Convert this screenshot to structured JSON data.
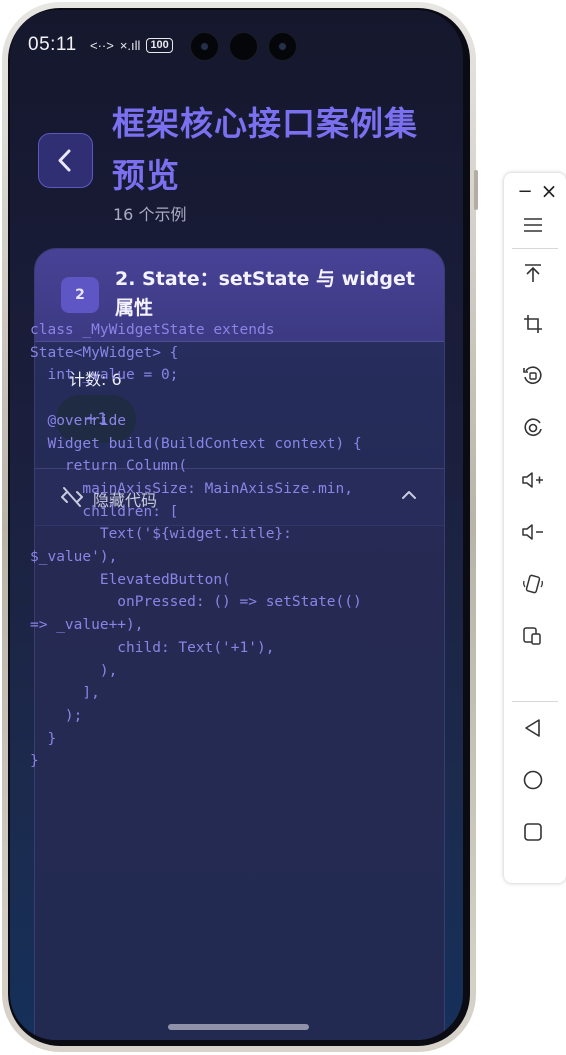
{
  "status_bar": {
    "time": "05:11",
    "data_icon": "<··>",
    "signal": "×.ıll",
    "battery": "100"
  },
  "header": {
    "title": "框架核心接口案例集预览",
    "subtitle": "16 个示例"
  },
  "example": {
    "number": "2",
    "title": "2. State：setState 与 widget 属性",
    "count_text": "计数: 6",
    "button_label": "+1",
    "code_toggle_label": "隐藏代码",
    "code": "class _MyWidgetState extends\nState<MyWidget> {\n  int _value = 0;\n\n  @override\n  Widget build(BuildContext context) {\n    return Column(\n      mainAxisSize: MainAxisSize.min,\n      children: [\n        Text('${widget.title}:\n$_value'),\n        ElevatedButton(\n          onPressed: () => setState(()\n=> _value++),\n          child: Text('+1'),\n        ),\n      ],\n    );\n  }\n}"
  },
  "toolbar": {
    "minimize": "−",
    "close": "×",
    "items": [
      "menu-icon",
      "pin-top-icon",
      "crop-icon",
      "rotate-icon",
      "screen-record-icon",
      "volume-up-icon",
      "volume-down-icon",
      "shake-icon",
      "multi-screen-icon",
      "back-nav-icon",
      "home-nav-icon",
      "recent-apps-icon"
    ]
  },
  "colors": {
    "accent": "#7b70f0",
    "card_header": "#484296",
    "background": "#1b1e3c"
  }
}
